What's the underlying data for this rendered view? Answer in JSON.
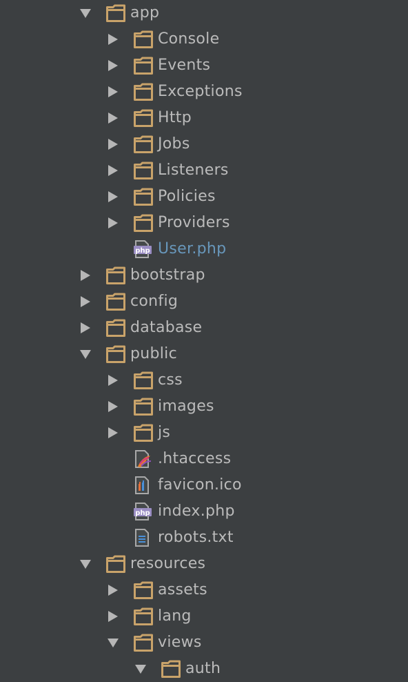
{
  "colors": {
    "background": "#3c3f41",
    "text": "#bbbbbb",
    "highlight_text": "#6897bb",
    "folder": "#c9a36a",
    "arrow": "#b6b6b6",
    "php_badge": "#9b8ec4"
  },
  "tree": [
    {
      "label": "app",
      "depth": 0,
      "type": "folder",
      "expanded": true,
      "icon": "folder-icon"
    },
    {
      "label": "Console",
      "depth": 1,
      "type": "folder",
      "expanded": false,
      "icon": "folder-icon"
    },
    {
      "label": "Events",
      "depth": 1,
      "type": "folder",
      "expanded": false,
      "icon": "folder-icon"
    },
    {
      "label": "Exceptions",
      "depth": 1,
      "type": "folder",
      "expanded": false,
      "icon": "folder-icon"
    },
    {
      "label": "Http",
      "depth": 1,
      "type": "folder",
      "expanded": false,
      "icon": "folder-icon"
    },
    {
      "label": "Jobs",
      "depth": 1,
      "type": "folder",
      "expanded": false,
      "icon": "folder-icon"
    },
    {
      "label": "Listeners",
      "depth": 1,
      "type": "folder",
      "expanded": false,
      "icon": "folder-icon"
    },
    {
      "label": "Policies",
      "depth": 1,
      "type": "folder",
      "expanded": false,
      "icon": "folder-icon"
    },
    {
      "label": "Providers",
      "depth": 1,
      "type": "folder",
      "expanded": false,
      "icon": "folder-icon"
    },
    {
      "label": "User.php",
      "depth": 1,
      "type": "file",
      "icon": "php-file-icon",
      "badge": "php",
      "highlight": true
    },
    {
      "label": "bootstrap",
      "depth": 0,
      "type": "folder",
      "expanded": false,
      "icon": "folder-icon"
    },
    {
      "label": "config",
      "depth": 0,
      "type": "folder",
      "expanded": false,
      "icon": "folder-icon"
    },
    {
      "label": "database",
      "depth": 0,
      "type": "folder",
      "expanded": false,
      "icon": "folder-icon"
    },
    {
      "label": "public",
      "depth": 0,
      "type": "folder",
      "expanded": true,
      "icon": "folder-icon"
    },
    {
      "label": "css",
      "depth": 1,
      "type": "folder",
      "expanded": false,
      "icon": "folder-icon"
    },
    {
      "label": "images",
      "depth": 1,
      "type": "folder",
      "expanded": false,
      "icon": "folder-icon"
    },
    {
      "label": "js",
      "depth": 1,
      "type": "folder",
      "expanded": false,
      "icon": "folder-icon"
    },
    {
      "label": ".htaccess",
      "depth": 1,
      "type": "file",
      "icon": "apache-file-icon"
    },
    {
      "label": "favicon.ico",
      "depth": 1,
      "type": "file",
      "icon": "image-file-icon"
    },
    {
      "label": "index.php",
      "depth": 1,
      "type": "file",
      "icon": "php-file-icon",
      "badge": "php"
    },
    {
      "label": "robots.txt",
      "depth": 1,
      "type": "file",
      "icon": "text-file-icon"
    },
    {
      "label": "resources",
      "depth": 0,
      "type": "folder",
      "expanded": true,
      "icon": "folder-icon"
    },
    {
      "label": "assets",
      "depth": 1,
      "type": "folder",
      "expanded": false,
      "icon": "folder-icon"
    },
    {
      "label": "lang",
      "depth": 1,
      "type": "folder",
      "expanded": false,
      "icon": "folder-icon"
    },
    {
      "label": "views",
      "depth": 1,
      "type": "folder",
      "expanded": true,
      "icon": "folder-icon"
    },
    {
      "label": "auth",
      "depth": 2,
      "type": "folder",
      "expanded": true,
      "icon": "folder-icon"
    }
  ]
}
